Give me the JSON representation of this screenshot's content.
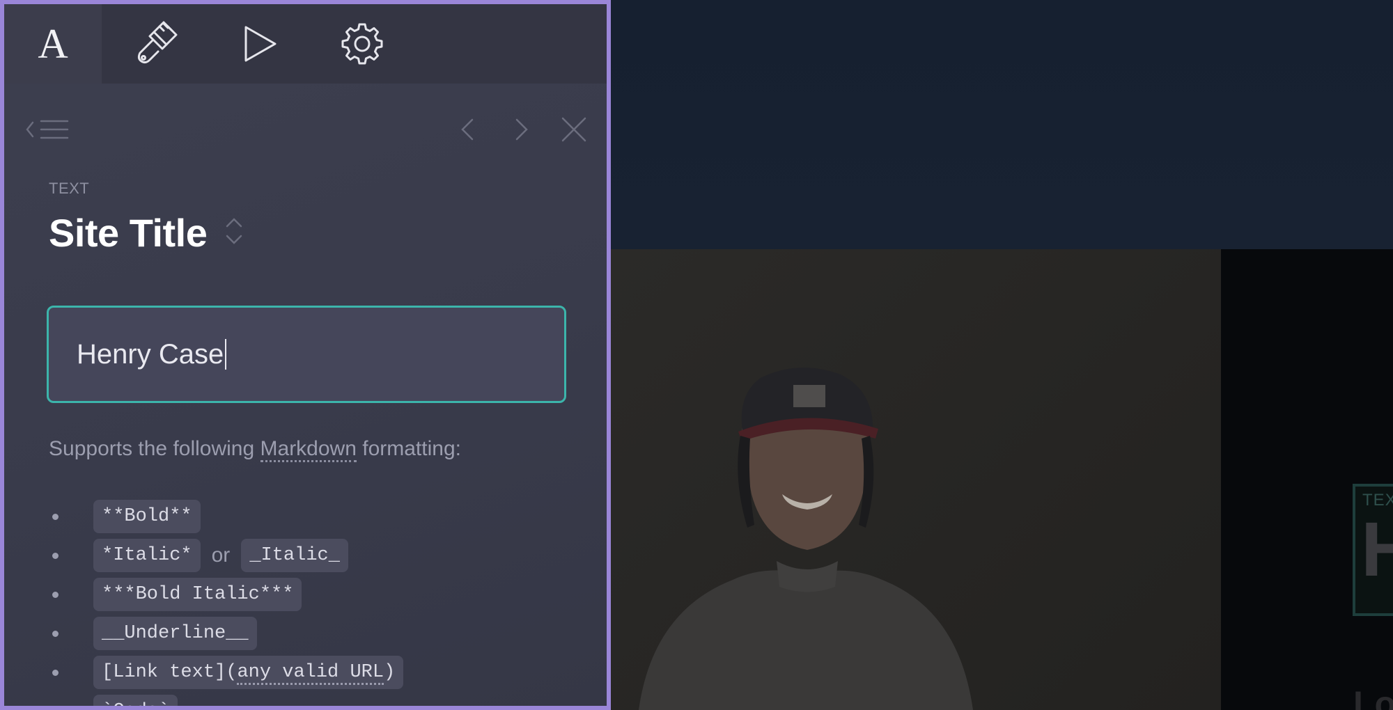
{
  "editor": {
    "tabs": [
      {
        "name": "text",
        "icon": "letter-a-icon",
        "glyph": "A",
        "active": true
      },
      {
        "name": "style",
        "icon": "paintbrush-icon",
        "active": false
      },
      {
        "name": "preview",
        "icon": "play-icon",
        "active": false
      },
      {
        "name": "settings",
        "icon": "gear-icon",
        "active": false
      }
    ],
    "section_label": "TEXT",
    "field_title": "Site Title",
    "input_value": "Henry Case",
    "help": {
      "prefix": "Supports the following ",
      "link": "Markdown",
      "suffix": " formatting:"
    },
    "formats": {
      "bold": "**Bold**",
      "italic_star": "*Italic*",
      "or": "or",
      "italic_underscore": "_Italic_",
      "bold_italic": "***Bold Italic***",
      "underline": "__Underline__",
      "link_prefix": "[Link text](",
      "link_url": "any valid URL",
      "link_suffix": ")",
      "code": "`Code`"
    },
    "colors": {
      "panel_border": "#9a86d8",
      "input_focus": "#3cb5ab"
    }
  },
  "preview": {
    "box_label": "TEX",
    "box_letter": "H",
    "bottom_text": "Lo"
  }
}
